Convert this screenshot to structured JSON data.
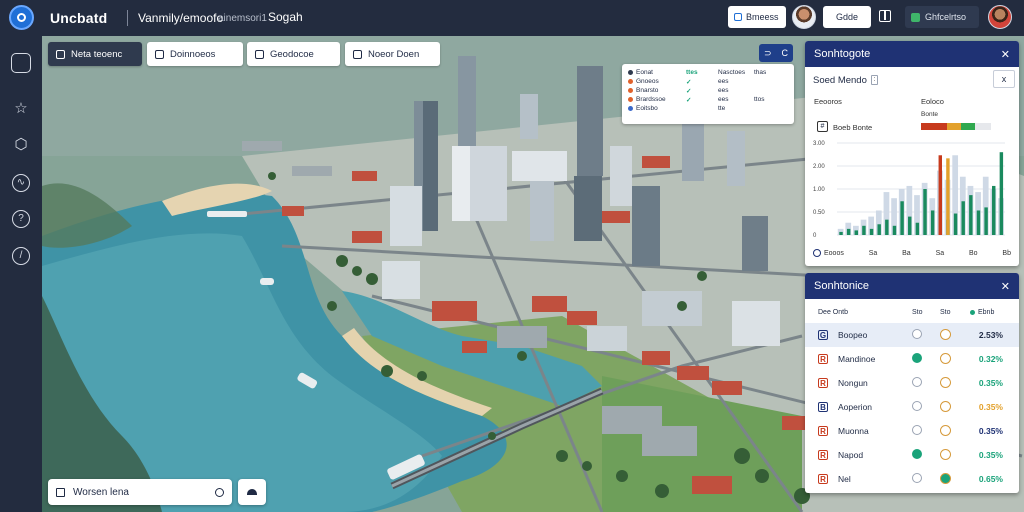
{
  "app": {
    "name": "Uncbatd",
    "project": "Vanmily/emoofo",
    "project_sub": "ainemsori1",
    "project_tag": "Sogah"
  },
  "header": {
    "primary_button": "Bmeess",
    "secondary_button": "Gdde",
    "workspace_button": "Ghfcelrtso"
  },
  "map_tabs": [
    {
      "label": "Neta teoenc",
      "active": true
    },
    {
      "label": "Doinnoeos",
      "active": false
    },
    {
      "label": "Geodocoe",
      "active": false
    },
    {
      "label": "Noeor Doen",
      "active": false
    }
  ],
  "search": {
    "placeholder": "Worsen lena"
  },
  "legend_card": {
    "rows": [
      {
        "name": "Eonat",
        "color": "#2f3a4e",
        "v1": "ttes",
        "v2": "Nasctoes",
        "v3": "thas"
      },
      {
        "name": "Gnoeos",
        "color": "#e0612b",
        "v1": "✓",
        "v2": "ees",
        "v3": ""
      },
      {
        "name": "Bnarsto",
        "color": "#e0612b",
        "v1": "✓",
        "v2": "ees",
        "v3": ""
      },
      {
        "name": "Brardssoe",
        "color": "#e0612b",
        "v1": "✓",
        "v2": "ees",
        "v3": "ttos"
      },
      {
        "name": "Eoitsbo",
        "color": "#3a68c9",
        "v1": "",
        "v2": "tte",
        "v3": ""
      }
    ]
  },
  "panel_analytics": {
    "title": "Sonhtogote",
    "select_label": "Soed Mendo",
    "close_icon_text": "x",
    "label_left": "Eeooros",
    "label_right": "Eoloco",
    "count_label": "Boeb Bonte",
    "count_value": "Bonte",
    "bar_colors": [
      "#c73a1d",
      "#e3a12c",
      "#2fa84f",
      "#e6e8ec"
    ],
    "chart_data": {
      "type": "bar",
      "ylim": [
        0,
        3.0
      ],
      "y_ticks": [
        "3.00",
        "2.00",
        "1.00",
        "0.50",
        "0"
      ],
      "series": [
        {
          "color": "#cfd9e6",
          "values": [
            0.2,
            0.4,
            0.3,
            0.5,
            0.6,
            0.8,
            1.4,
            1.2,
            1.5,
            1.6,
            1.3,
            1.7,
            1.2,
            2.1,
            1.8,
            2.6,
            1.9,
            1.6,
            1.4,
            1.9,
            1.5,
            1.2
          ]
        },
        {
          "color": "#1a8a5e",
          "values": [
            0.1,
            0.2,
            0.15,
            0.3,
            0.2,
            0.35,
            0.5,
            0.3,
            1.1,
            0.6,
            0.4,
            1.5,
            0.8,
            0.9,
            0.5,
            0.7,
            1.1,
            1.3,
            0.8,
            0.9,
            1.6,
            2.7
          ]
        },
        {
          "color": "#c73a1d",
          "values": [
            0,
            0,
            0,
            0,
            0,
            0,
            0,
            0,
            0,
            0,
            0,
            0,
            0,
            2.6,
            0,
            0,
            0,
            0,
            0,
            0,
            0,
            0
          ]
        },
        {
          "color": "#e3a12c",
          "values": [
            0,
            0,
            0,
            0,
            0,
            0,
            0,
            0,
            0,
            0,
            0,
            0,
            0,
            0,
            2.5,
            0,
            0,
            0,
            0,
            0,
            0,
            0
          ]
        }
      ]
    },
    "footer": [
      "Eooos",
      "Sa",
      "Ba",
      "Sa",
      "Bo",
      "Bb"
    ]
  },
  "panel_list": {
    "title": "Sonhtonice",
    "columns": [
      "Dee Ontb",
      "Sto",
      "Sto",
      "Ebnb"
    ],
    "rows": [
      {
        "name": "Boopeo",
        "icon": "G",
        "icon_color": "#1f3274",
        "a_color": "#ffffff",
        "b_color": "#ffffff",
        "value": "2.53%",
        "val_color": "#1f2a44",
        "highlight": true
      },
      {
        "name": "Mandinoe",
        "icon": "R",
        "icon_color": "#c73a1d",
        "a_color": "#1aa37a",
        "b_color": "#ffffff",
        "value": "0.32%",
        "val_color": "#1aa37a",
        "highlight": false
      },
      {
        "name": "Nongun",
        "icon": "R",
        "icon_color": "#c73a1d",
        "a_color": "#ffffff",
        "b_color": "#ffffff",
        "value": "0.35%",
        "val_color": "#1aa37a",
        "highlight": false
      },
      {
        "name": "Aoperion",
        "icon": "B",
        "icon_color": "#1f3274",
        "a_color": "#ffffff",
        "b_color": "#ffffff",
        "value": "0.35%",
        "val_color": "#e3a12c",
        "highlight": false
      },
      {
        "name": "Muonna",
        "icon": "R",
        "icon_color": "#c73a1d",
        "a_color": "#ffffff",
        "b_color": "#ffffff",
        "value": "0.35%",
        "val_color": "#1f3274",
        "highlight": false
      },
      {
        "name": "Napod",
        "icon": "R",
        "icon_color": "#c73a1d",
        "a_color": "#1aa37a",
        "b_color": "#ffffff",
        "value": "0.35%",
        "val_color": "#1aa37a",
        "highlight": false
      },
      {
        "name": "Nel",
        "icon": "R",
        "icon_color": "#c73a1d",
        "a_color": "#ffffff",
        "b_color": "#1aa37a",
        "value": "0.65%",
        "val_color": "#1aa37a",
        "highlight": false
      }
    ]
  },
  "zoom": {
    "in": "⊃",
    "out": "C"
  },
  "rail_icons": [
    "home-icon",
    "shape-icon",
    "shield-icon",
    "analytics-icon",
    "compass-icon",
    "clock-icon"
  ]
}
